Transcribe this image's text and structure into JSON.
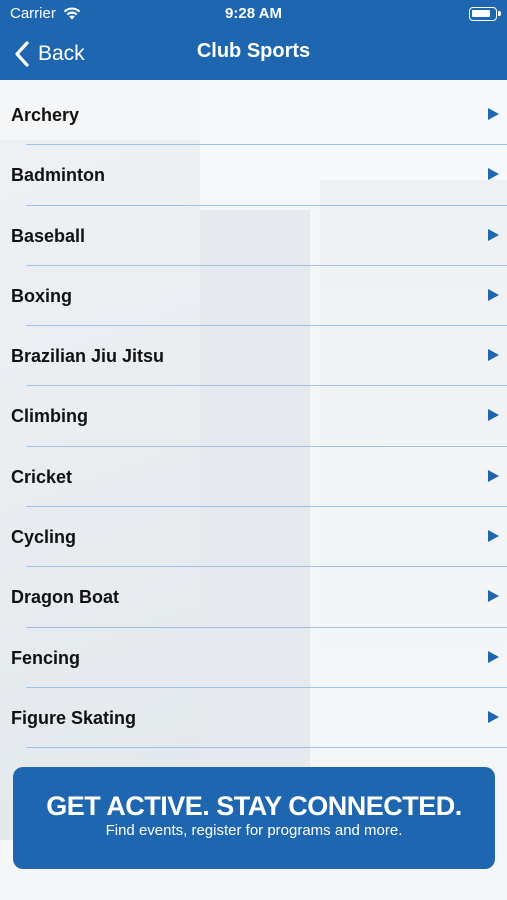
{
  "status": {
    "carrier": "Carrier",
    "time": "9:28 AM"
  },
  "nav": {
    "back_label": "Back",
    "title": "Club Sports"
  },
  "sports": [
    "Archery",
    "Badminton",
    "Baseball",
    "Boxing",
    "Brazilian Jiu Jitsu",
    "Climbing",
    "Cricket",
    "Cycling",
    "Dragon Boat",
    "Fencing",
    "Figure Skating"
  ],
  "banner": {
    "headline": "GET ACTIVE.  STAY CONNECTED.",
    "subtext": "Find events, register for programs and more."
  },
  "colors": {
    "brand_blue": "#1e67b0",
    "divider": "#9cc3e6"
  },
  "icons": {
    "wifi": "wifi-icon",
    "battery": "battery-icon",
    "back": "chevron-left-icon",
    "row_arrow": "triangle-right-icon"
  }
}
